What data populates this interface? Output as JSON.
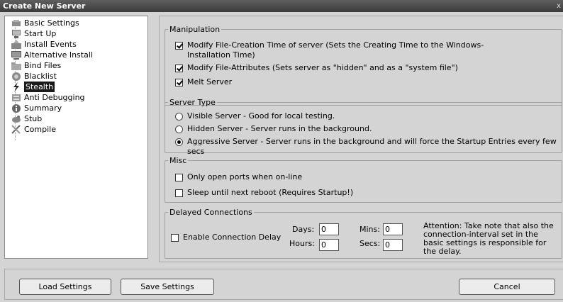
{
  "window": {
    "title": "Create New Server",
    "close_glyph": "x"
  },
  "tree": {
    "items": [
      {
        "label": "Basic Settings",
        "icon": "wrench-icon",
        "selected": false
      },
      {
        "label": "Start Up",
        "icon": "computer-icon",
        "selected": false
      },
      {
        "label": "Install Events",
        "icon": "install-icon",
        "selected": false
      },
      {
        "label": "Alternative Install",
        "icon": "monitor-icon",
        "selected": false
      },
      {
        "label": "Bind Files",
        "icon": "folder-icon",
        "selected": false
      },
      {
        "label": "Blacklist",
        "icon": "blacklist-icon",
        "selected": false
      },
      {
        "label": "Stealth",
        "icon": "stealth-icon",
        "selected": true
      },
      {
        "label": "Anti Debugging",
        "icon": "debug-icon",
        "selected": false
      },
      {
        "label": "Summary",
        "icon": "info-icon",
        "selected": false
      },
      {
        "label": "Stub",
        "icon": "stub-icon",
        "selected": false
      },
      {
        "label": "Compile",
        "icon": "compile-icon",
        "selected": false
      }
    ]
  },
  "manipulation": {
    "legend": "Manipulation",
    "options": [
      {
        "label": "Modify File-Creation Time of server (Sets the Creating Time to the Windows-Installation Time)",
        "checked": true
      },
      {
        "label": "Modify File-Attributes (Sets server as \"hidden\" and as a \"system file\")",
        "checked": true
      },
      {
        "label": "Melt Server",
        "checked": true
      }
    ]
  },
  "server_type": {
    "legend": "Server Type",
    "options": [
      {
        "label": "Visible Server - Good for local testing.",
        "checked": false
      },
      {
        "label": "Hidden Server - Server runs in the background.",
        "checked": false
      },
      {
        "label": "Aggressive Server - Server runs in the background and will force the Startup Entries every few secs",
        "checked": true
      }
    ]
  },
  "misc": {
    "legend": "Misc",
    "options": [
      {
        "label": "Only open ports when on-line",
        "checked": false
      },
      {
        "label": "Sleep until next reboot (Requires Startup!)",
        "checked": false
      }
    ]
  },
  "delayed": {
    "legend": "Delayed Connections",
    "enable_label": "Enable Connection Delay",
    "enable_checked": false,
    "days_label": "Days:",
    "days_value": "0",
    "hours_label": "Hours:",
    "hours_value": "0",
    "mins_label": "Mins:",
    "mins_value": "0",
    "secs_label": "Secs:",
    "secs_value": "0",
    "attention": "Attention: Take note that also the connection-interval set in the basic settings is responsible for the delay."
  },
  "buttons": {
    "load": "Load Settings",
    "save": "Save Settings",
    "cancel": "Cancel"
  }
}
